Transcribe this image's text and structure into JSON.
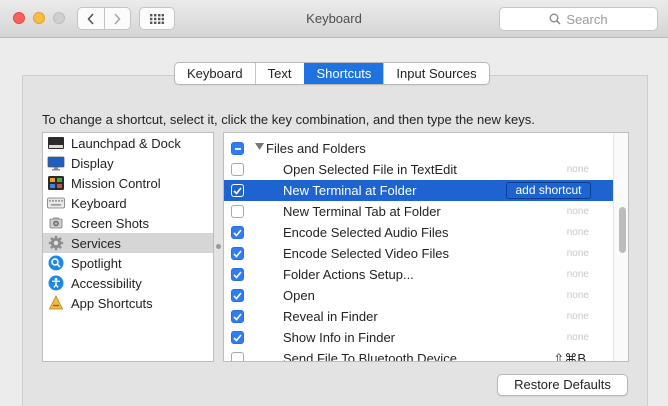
{
  "window": {
    "title": "Keyboard"
  },
  "toolbar": {
    "search_placeholder": "Search"
  },
  "tabs": [
    {
      "label": "Keyboard",
      "active": false
    },
    {
      "label": "Text",
      "active": false
    },
    {
      "label": "Shortcuts",
      "active": true
    },
    {
      "label": "Input Sources",
      "active": false
    }
  ],
  "instructions": "To change a shortcut, select it, click the key combination, and then type the new keys.",
  "categories": [
    {
      "label": "Launchpad & Dock",
      "icon": "launchpad-dock-icon"
    },
    {
      "label": "Display",
      "icon": "display-icon"
    },
    {
      "label": "Mission Control",
      "icon": "mission-control-icon"
    },
    {
      "label": "Keyboard",
      "icon": "keyboard-icon"
    },
    {
      "label": "Screen Shots",
      "icon": "screenshot-icon"
    },
    {
      "label": "Services",
      "icon": "gear-icon",
      "selected": true
    },
    {
      "label": "Spotlight",
      "icon": "spotlight-icon"
    },
    {
      "label": "Accessibility",
      "icon": "accessibility-icon"
    },
    {
      "label": "App Shortcuts",
      "icon": "app-shortcuts-icon"
    }
  ],
  "shortcuts": {
    "group_label": "Files and Folders",
    "add_shortcut_label": "add shortcut",
    "rows": [
      {
        "label": "Open Selected File in TextEdit",
        "checked": false,
        "key": "none"
      },
      {
        "label": "New Terminal at Folder",
        "checked": true,
        "key": "",
        "selected": true
      },
      {
        "label": "New Terminal Tab at Folder",
        "checked": false,
        "key": "none"
      },
      {
        "label": "Encode Selected Audio Files",
        "checked": true,
        "key": "none"
      },
      {
        "label": "Encode Selected Video Files",
        "checked": true,
        "key": "none"
      },
      {
        "label": "Folder Actions Setup...",
        "checked": true,
        "key": "none"
      },
      {
        "label": "Open",
        "checked": true,
        "key": "none"
      },
      {
        "label": "Reveal in Finder",
        "checked": true,
        "key": "none"
      },
      {
        "label": "Show Info in Finder",
        "checked": true,
        "key": "none"
      },
      {
        "label": "Send File To Bluetooth Device",
        "checked": false,
        "key": "⇧⌘B"
      }
    ]
  },
  "footer": {
    "restore_label": "Restore Defaults"
  },
  "colors": {
    "accent": "#1e64d0",
    "close": "#fc605c",
    "minimize": "#fdbc40"
  }
}
